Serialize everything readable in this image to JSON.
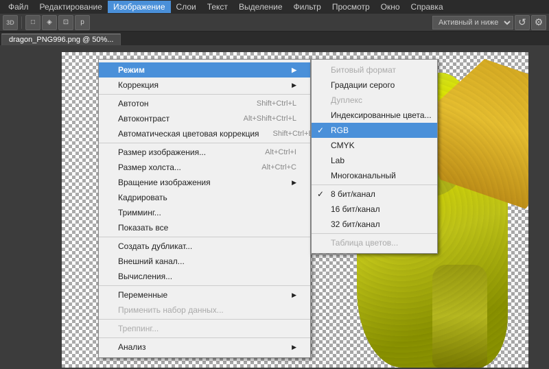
{
  "menubar": {
    "items": [
      {
        "label": "Файл",
        "id": "file"
      },
      {
        "label": "Редактирование",
        "id": "edit"
      },
      {
        "label": "Изображение",
        "id": "image"
      },
      {
        "label": "Слои",
        "id": "layers"
      },
      {
        "label": "Текст",
        "id": "text"
      },
      {
        "label": "Выделение",
        "id": "select"
      },
      {
        "label": "Фильтр",
        "id": "filter"
      },
      {
        "label": "Просмотр",
        "id": "view"
      },
      {
        "label": "Окно",
        "id": "window"
      },
      {
        "label": "Справка",
        "id": "help"
      }
    ]
  },
  "toolbar": {
    "select_label": "Активный и ниже"
  },
  "tab": {
    "label": "dragon_PNG996.png @ 50%..."
  },
  "image_menu": {
    "title": "Изображение",
    "items": [
      {
        "label": "Режим",
        "type": "arrow",
        "id": "mode"
      },
      {
        "label": "Коррекция",
        "type": "arrow",
        "id": "correction"
      },
      {
        "type": "separator"
      },
      {
        "label": "Автотон",
        "shortcut": "Shift+Ctrl+L",
        "id": "auto-tone"
      },
      {
        "label": "Автоконтраст",
        "shortcut": "Alt+Shift+Ctrl+L",
        "id": "auto-contrast"
      },
      {
        "label": "Автоматическая цветовая коррекция",
        "shortcut": "Shift+Ctrl+B",
        "id": "auto-color"
      },
      {
        "type": "separator"
      },
      {
        "label": "Размер изображения...",
        "shortcut": "Alt+Ctrl+I",
        "id": "image-size"
      },
      {
        "label": "Размер холста...",
        "shortcut": "Alt+Ctrl+C",
        "id": "canvas-size"
      },
      {
        "label": "Вращение изображения",
        "type": "arrow",
        "id": "rotate"
      },
      {
        "label": "Кадрировать",
        "id": "crop"
      },
      {
        "label": "Тримминг...",
        "id": "trim"
      },
      {
        "label": "Показать все",
        "id": "reveal-all"
      },
      {
        "type": "separator"
      },
      {
        "label": "Создать дубликат...",
        "id": "duplicate"
      },
      {
        "label": "Внешний канал...",
        "id": "apply-image"
      },
      {
        "label": "Вычисления...",
        "id": "calculations"
      },
      {
        "type": "separator"
      },
      {
        "label": "Переменные",
        "type": "arrow",
        "id": "variables"
      },
      {
        "label": "Применить набор данных...",
        "id": "apply-data"
      },
      {
        "type": "separator"
      },
      {
        "label": "Треппинг...",
        "id": "trap"
      },
      {
        "type": "separator"
      },
      {
        "label": "Анализ",
        "type": "arrow",
        "id": "analysis"
      }
    ]
  },
  "mode_submenu": {
    "items": [
      {
        "label": "Битовый формат",
        "id": "bitmap",
        "disabled": true
      },
      {
        "label": "Градации серого",
        "id": "grayscale",
        "disabled": false
      },
      {
        "label": "Дуплекс",
        "id": "duotone",
        "disabled": true
      },
      {
        "label": "Индексированные цвета...",
        "id": "indexed",
        "disabled": false
      },
      {
        "label": "RGB",
        "id": "rgb",
        "checked": true,
        "highlighted": true
      },
      {
        "label": "CMYK",
        "id": "cmyk"
      },
      {
        "label": "Lab",
        "id": "lab"
      },
      {
        "label": "Многоканальный",
        "id": "multichannel"
      },
      {
        "type": "separator"
      },
      {
        "label": "8 бит/канал",
        "id": "8bit",
        "checked": true
      },
      {
        "label": "16 бит/канал",
        "id": "16bit"
      },
      {
        "label": "32 бит/канал",
        "id": "32bit"
      },
      {
        "type": "separator"
      },
      {
        "label": "Таблица цветов...",
        "id": "color-table",
        "disabled": true
      }
    ]
  }
}
